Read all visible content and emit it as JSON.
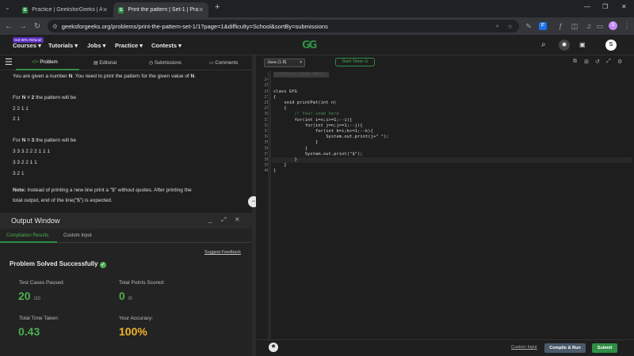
{
  "browser": {
    "tabs": [
      {
        "title": "Practice | GeeksforGeeks | A co"
      },
      {
        "title": "Print the pattern | Set-1 | Practi"
      }
    ],
    "new_tab": "+",
    "url": "geeksforgeeks.org/problems/print-the-pattern-set-1/1?page=1&difficulty=School&sortBy=submissions",
    "profile_initial": "S"
  },
  "nav": {
    "badge": "Get 90% Refund!",
    "items": [
      "Courses",
      "Tutorials",
      "Jobs",
      "Practice",
      "Contests"
    ],
    "logo": "GG",
    "avatar": "S"
  },
  "left_tabs": [
    "Problem",
    "Editorial",
    "Submissions",
    "Comments"
  ],
  "problem": {
    "intro": [
      "You are given a number ",
      "N",
      ". You need to print the pattern for the given value of ",
      "N",
      "."
    ],
    "ex1_label": [
      "For ",
      "N = 2",
      " the pattern will be"
    ],
    "ex1_lines": [
      "2 2 1 1",
      "2 1"
    ],
    "ex2_label": [
      "For ",
      "N = 3",
      " the pattern will be"
    ],
    "ex2_lines": [
      "3 3 3 2 2 2 1 1 1",
      "3 3 2 2 1 1",
      "3 2 1"
    ],
    "note_bold": "Note:",
    "note": " Instead of printing a new line print a \"$\" without quotes. After printing the",
    "note2": "total output, end of the line(\"$\") is expected."
  },
  "output": {
    "title": "Output Window",
    "tabs": [
      "Compilation Results",
      "Custom Input"
    ],
    "suggest": "Suggest Feedback",
    "status": "Problem Solved Successfully",
    "stats": [
      {
        "label": "Test Cases Passed:",
        "value": "20",
        "sub": "/20"
      },
      {
        "label": "Total Points Scored:",
        "value": "0",
        "sub": "/0"
      },
      {
        "label": "Total Time Taken:",
        "value": "0.43",
        "sub": ""
      },
      {
        "label": "Your Accuracy:",
        "value": "100%",
        "sub": ""
      }
    ]
  },
  "editor": {
    "language": "Java (1.8)",
    "timer": "Start Timer",
    "lines": [
      {
        "n": "1",
        "code": "//Initial Code Here"
      },
      {
        "n": "24",
        "code": ""
      },
      {
        "n": "25",
        "code": ""
      },
      {
        "n": "26",
        "code": "class GfG"
      },
      {
        "n": "27",
        "code": "{"
      },
      {
        "n": "28",
        "code": "    void printPat(int n)"
      },
      {
        "n": "29",
        "code": "    {"
      },
      {
        "n": "30",
        "code": "        // Your code here"
      },
      {
        "n": "31",
        "code": "        for(int i=n;i>=1;--i){"
      },
      {
        "n": "32",
        "code": "            for(int j=n;j>=1;--j){"
      },
      {
        "n": "33",
        "code": "                for(int k=i;k>=1;--k){"
      },
      {
        "n": "34",
        "code": "                    System.out.print(j+\" \");"
      },
      {
        "n": "35",
        "code": "                }"
      },
      {
        "n": "36",
        "code": "            }"
      },
      {
        "n": "37",
        "code": "            System.out.print(\"$\");"
      },
      {
        "n": "38",
        "code": "        }"
      },
      {
        "n": "39",
        "code": "    }"
      },
      {
        "n": "40",
        "code": "}"
      }
    ],
    "custom_input": "Custom Input",
    "compile": "Compile & Run",
    "submit": "Submit"
  },
  "colors": {
    "green": "#2f8d46",
    "stat_green": "#4caf50",
    "accuracy": "#f0b429",
    "dark": "#1e1e1e"
  }
}
